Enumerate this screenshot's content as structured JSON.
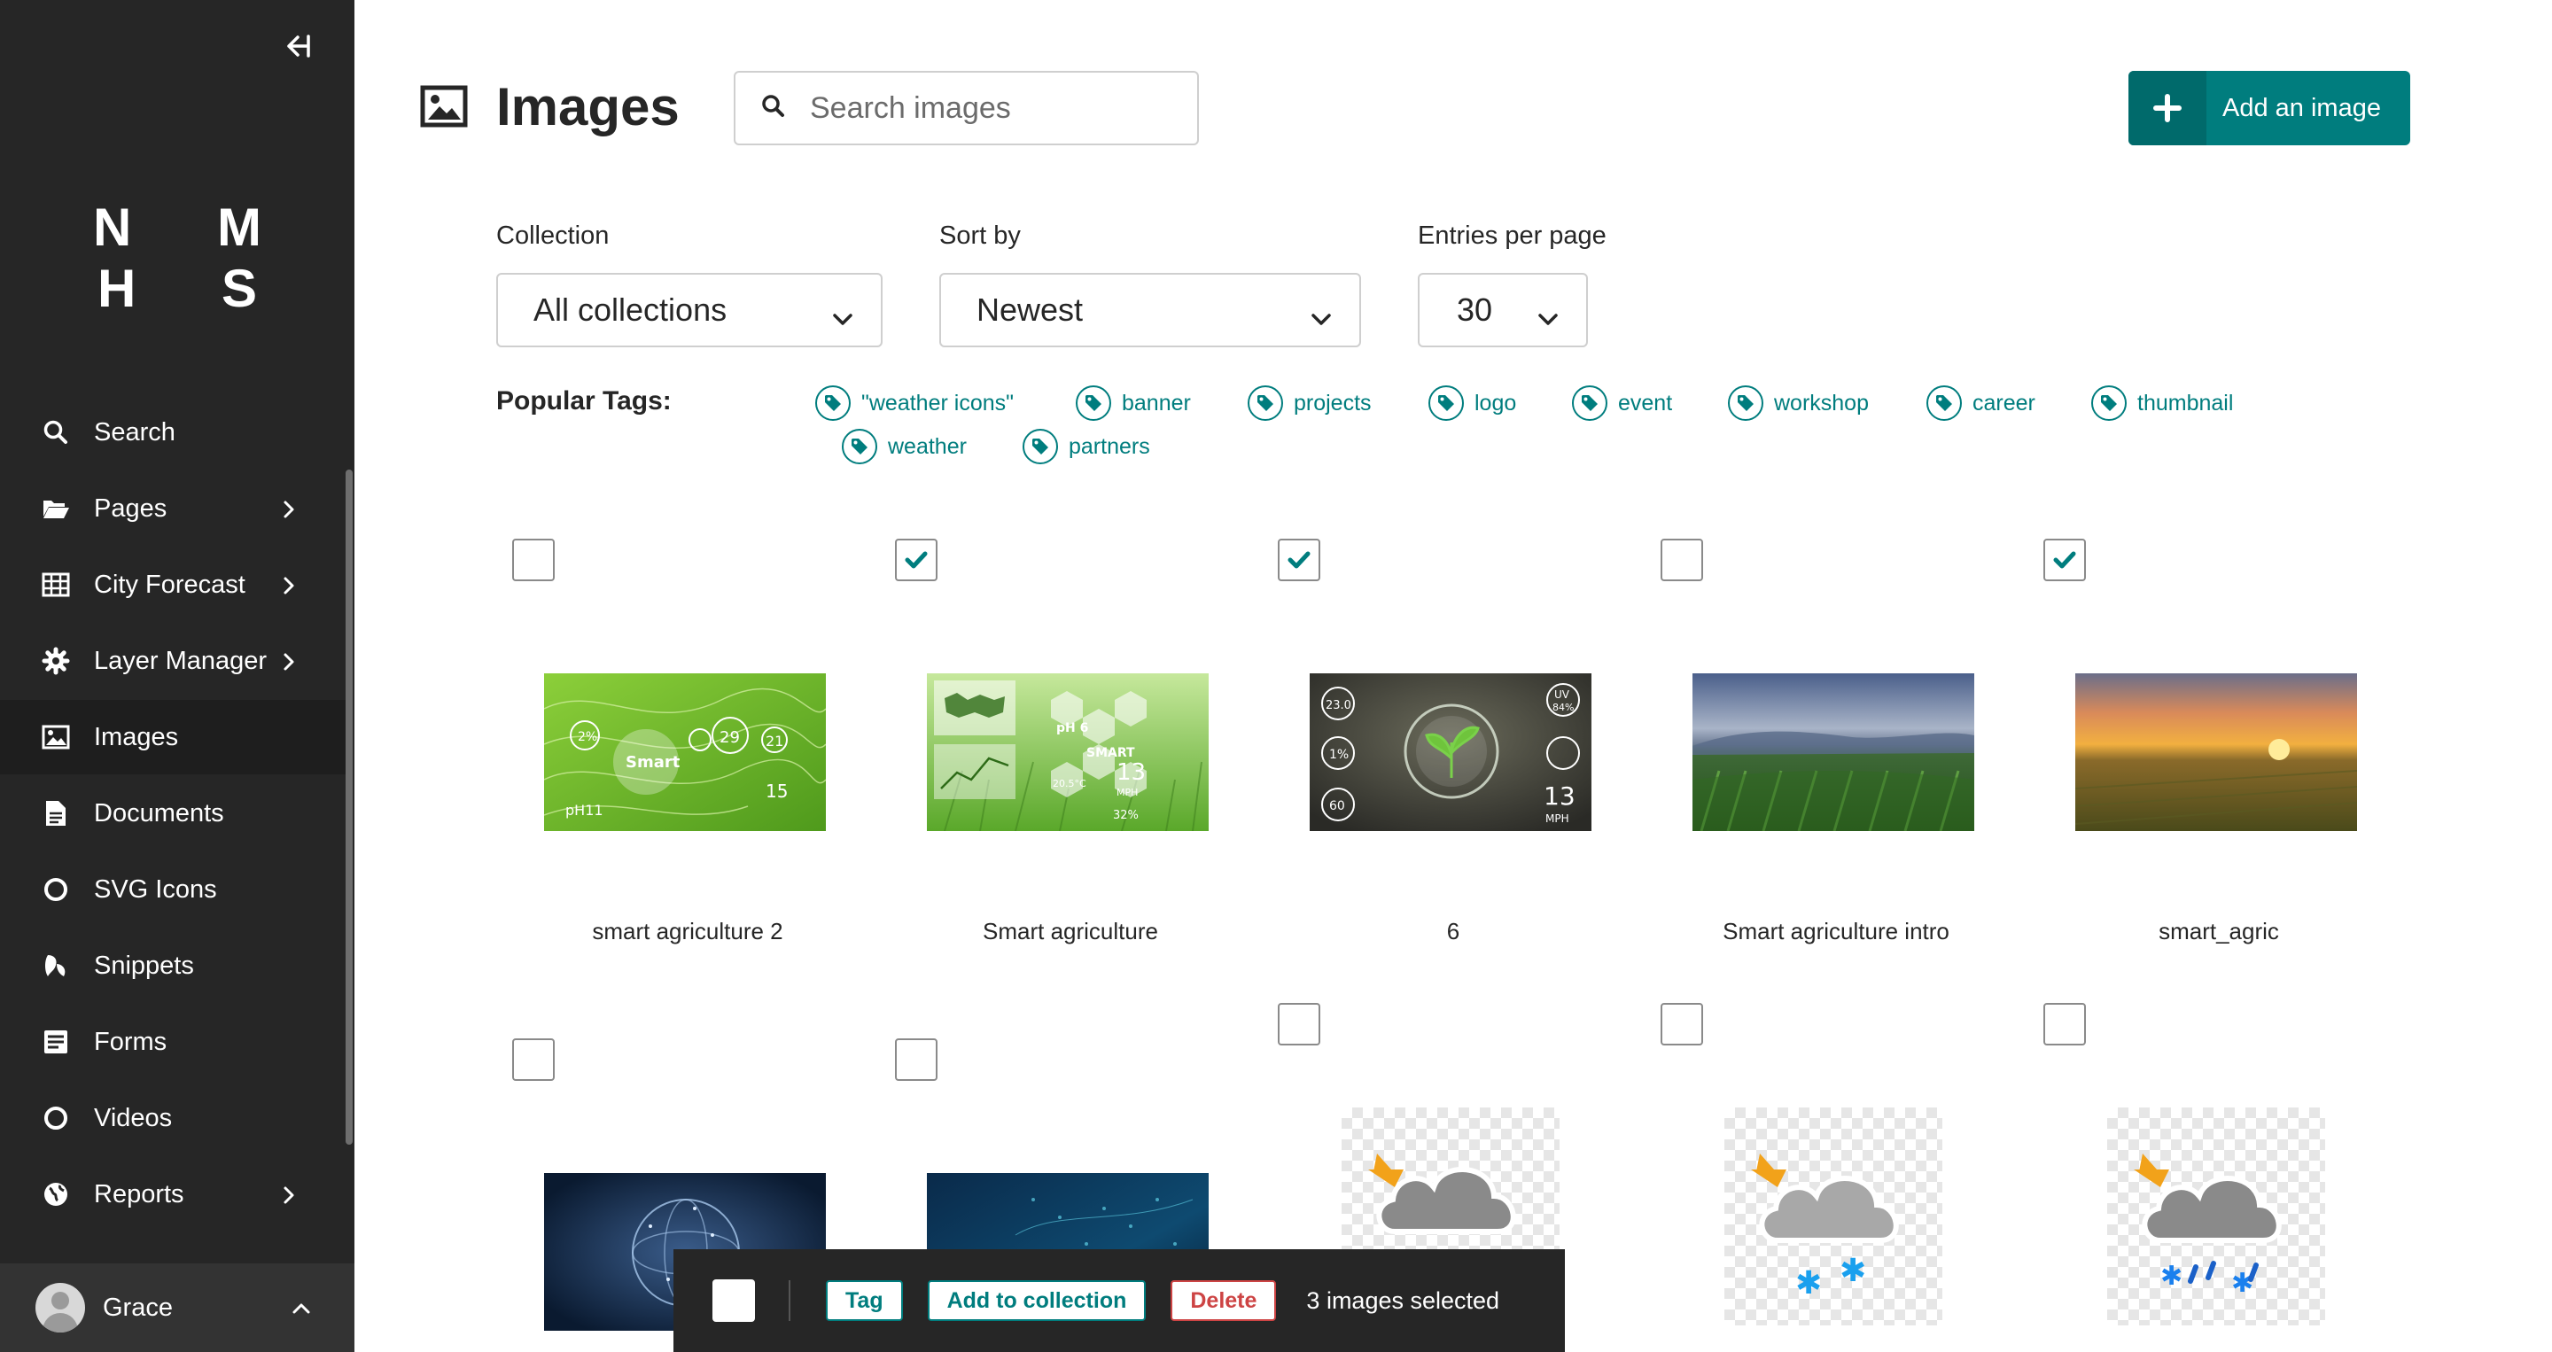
{
  "sidebar": {
    "logo": "N M H S",
    "items": [
      {
        "label": "Search",
        "icon": "search-icon",
        "chevron": false
      },
      {
        "label": "Pages",
        "icon": "folder-open-icon",
        "chevron": true
      },
      {
        "label": "City Forecast",
        "icon": "table-icon",
        "chevron": true
      },
      {
        "label": "Layer Manager",
        "icon": "cog-icon",
        "chevron": true
      },
      {
        "label": "Images",
        "icon": "image-icon",
        "chevron": false,
        "active": true
      },
      {
        "label": "Documents",
        "icon": "document-icon",
        "chevron": false
      },
      {
        "label": "SVG Icons",
        "icon": "circle-icon",
        "chevron": false
      },
      {
        "label": "Snippets",
        "icon": "snippet-icon",
        "chevron": false
      },
      {
        "label": "Forms",
        "icon": "form-icon",
        "chevron": false
      },
      {
        "label": "Videos",
        "icon": "circle-icon",
        "chevron": false
      },
      {
        "label": "Reports",
        "icon": "globe-icon",
        "chevron": true
      }
    ],
    "user": {
      "name": "Grace"
    }
  },
  "header": {
    "title": "Images",
    "search_placeholder": "Search images",
    "add_label": "Add an image"
  },
  "filters": {
    "collection": {
      "label": "Collection",
      "value": "All collections"
    },
    "sort": {
      "label": "Sort by",
      "value": "Newest"
    },
    "per_page": {
      "label": "Entries per page",
      "value": "30"
    }
  },
  "tags": {
    "label": "Popular Tags:",
    "items": [
      "\"weather icons\"",
      "banner",
      "projects",
      "logo",
      "event",
      "workshop",
      "career",
      "thumbnail",
      "weather",
      "partners"
    ]
  },
  "images": [
    {
      "title": "smart agriculture 2",
      "checked": false
    },
    {
      "title": "Smart agriculture",
      "checked": true
    },
    {
      "title": "6",
      "checked": true
    },
    {
      "title": "Smart agriculture intro",
      "checked": false
    },
    {
      "title": "smart_agric",
      "checked": true
    },
    {
      "title": "",
      "checked": false
    },
    {
      "title": "",
      "checked": false
    },
    {
      "title": "",
      "checked": false
    },
    {
      "title": "",
      "checked": false
    },
    {
      "title": "",
      "checked": false
    }
  ],
  "thumbnail_labels": {
    "t1": [
      "2%",
      "Smart",
      "29",
      "21",
      "15",
      "pH11"
    ],
    "t2": [
      "pH 6",
      "SMART",
      "13",
      "MPH",
      "20.5°C",
      "32%"
    ],
    "t3": [
      "23.0",
      "1%",
      "60",
      "UV",
      "84%",
      "13",
      "MPH"
    ]
  },
  "bulk": {
    "tag_label": "Tag",
    "collection_label": "Add to collection",
    "delete_label": "Delete",
    "selected_text": "3 images selected"
  },
  "colors": {
    "sidebar_bg": "#262626",
    "primary": "#007d7e",
    "danger": "#cd4444"
  }
}
